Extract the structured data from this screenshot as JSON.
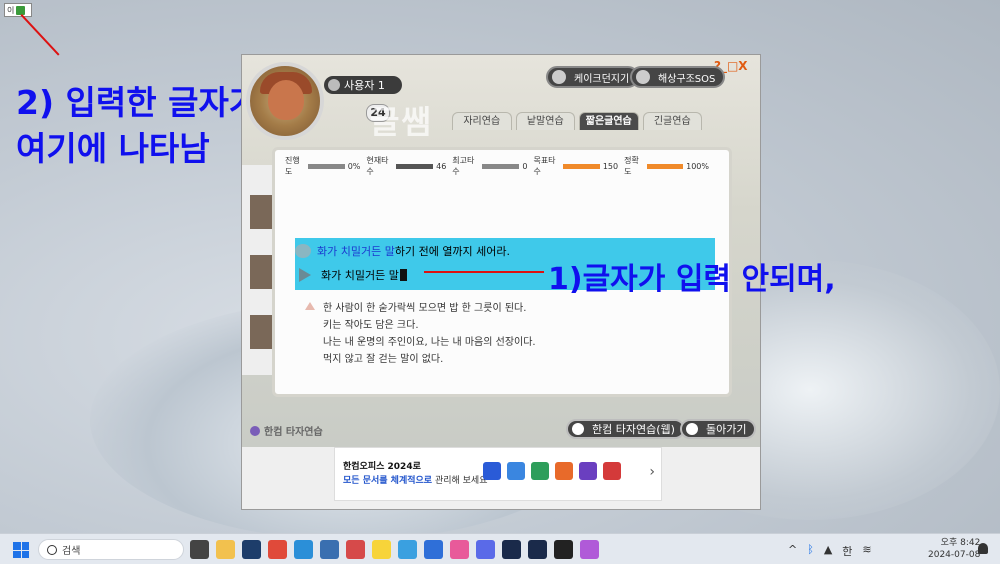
{
  "annotations": {
    "line1": "2) 입력한 글자가",
    "line2": "여기에 나타남",
    "note1": "1)글자가 입력 안되며,"
  },
  "ime_indicator": {
    "char": "이"
  },
  "window": {
    "controls": "?_□X",
    "user": {
      "name": "사용자 1",
      "level": "24"
    },
    "brand_ghost": "글쌤",
    "top_buttons": {
      "game": "케이크던지기",
      "sos": "해상구조SOS"
    },
    "tabs": [
      "자리연습",
      "낱말연습",
      "짧은글연습",
      "긴글연습"
    ],
    "active_tab": "짧은글연습",
    "stats": {
      "progress_label": "진행도",
      "progress_value": "0%",
      "current_speed_label": "현재타수",
      "current_speed_value": "46",
      "best_speed_label": "최고타수",
      "best_speed_value": "0",
      "target_speed_label": "목표타수",
      "target_speed_value": "150",
      "accuracy_label": "정확도",
      "accuracy_value": "100%"
    },
    "practice": {
      "sentence_typed_part": "화가 치밀거든 말",
      "sentence_rest": "하기 전에 열까지 세어라.",
      "input_text": "화가 치밀거든 말",
      "next_lines": [
        "한 사람이 한 숟가락씩 모으면 밥 한 그릇이 된다.",
        "키는 작아도 담은 크다.",
        "나는 내 운명의 주인이요, 나는 내 마음의 선장이다.",
        "먹지 않고 잘 걷는 말이 없다."
      ]
    },
    "footer": {
      "logo_text": "한컴 타자연습",
      "web_button": "한컴 타자연습(웹)",
      "back_button": "돌아가기"
    },
    "ad": {
      "title": "한컴오피스 2024로",
      "sub_highlight": "모든 문서를 체계적으로",
      "sub_rest": " 관리해 보세요",
      "next_arrow": "›"
    }
  },
  "taskbar": {
    "search_placeholder": "검색",
    "tray_lang": "한",
    "clock_time": "오후 8:42",
    "clock_date": "2024-07-08",
    "tray_chevron": "^"
  }
}
